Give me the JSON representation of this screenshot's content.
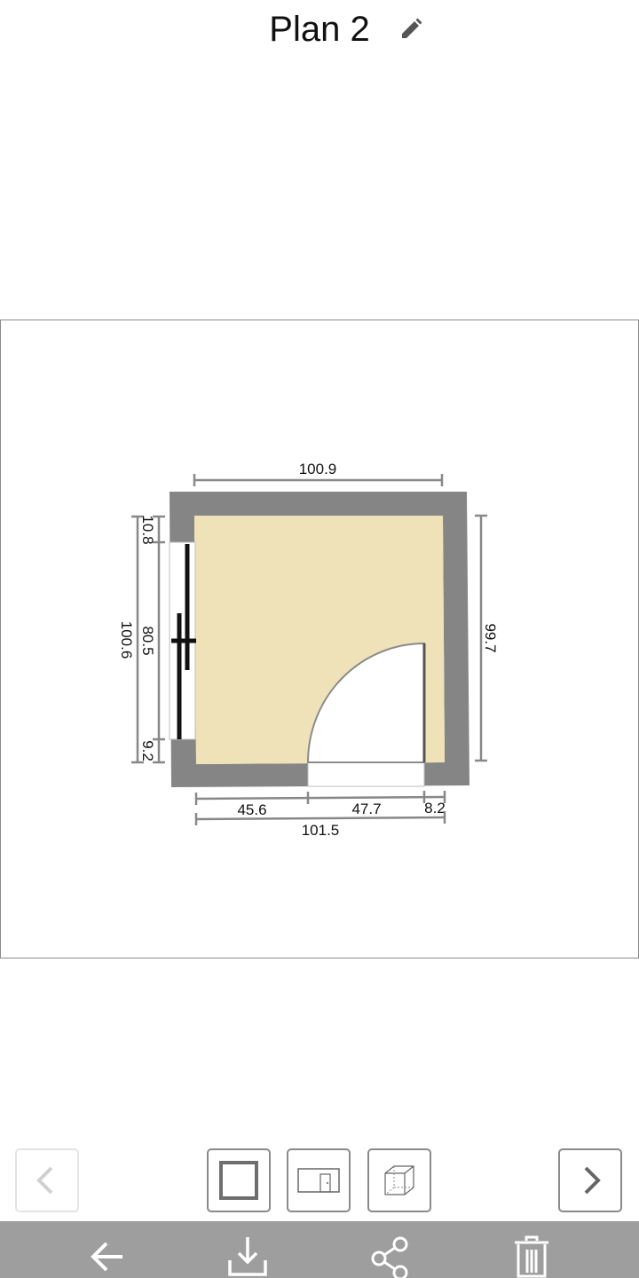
{
  "header": {
    "title": "Plan 2"
  },
  "plan": {
    "dimensions": {
      "top_width": "100.9",
      "right_height": "99.7",
      "left_total": "100.6",
      "left_top_segment": "10.8",
      "left_window_segment": "80.5",
      "left_bottom_segment": "9.2",
      "bottom_segment_1": "45.6",
      "bottom_segment_2": "47.7",
      "bottom_segment_3": "8.2",
      "bottom_total": "101.5"
    },
    "colors": {
      "wall": "#858585",
      "floor": "#f0e2b8",
      "dimension_line": "#888888",
      "frame_border": "#8a8a8a"
    }
  },
  "toolbar": {
    "prev_icon": "chevron-left-icon",
    "plan_view_icon": "square-outline-icon",
    "wall_view_icon": "door-elevation-icon",
    "view_3d_icon": "cube-3d-icon",
    "next_icon": "chevron-right-icon"
  },
  "bottom_bar": {
    "background": "#9e9e9e",
    "icons": [
      "back-arrow-icon",
      "download-icon",
      "share-icon",
      "trash-icon"
    ]
  }
}
